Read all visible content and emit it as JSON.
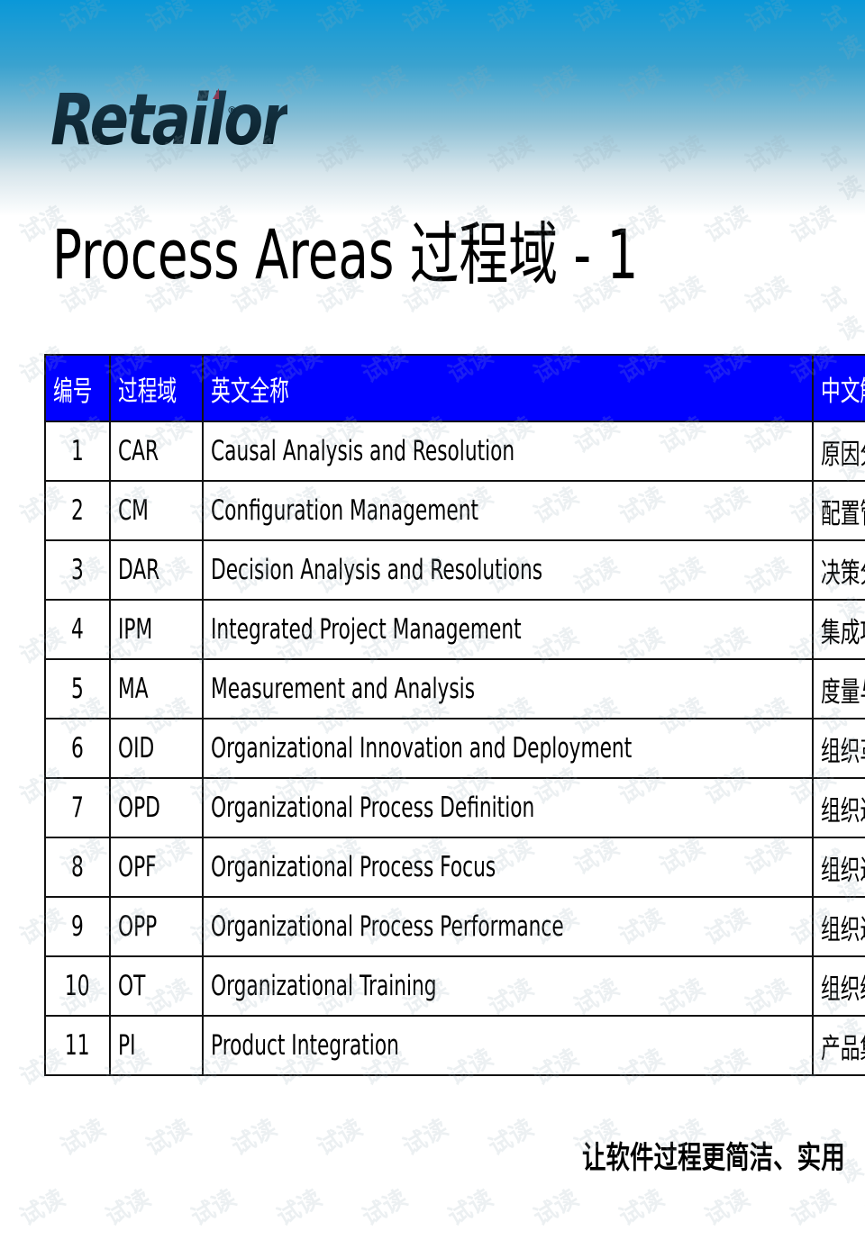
{
  "brand": {
    "logo_text": "Retailor",
    "registered_mark": "®"
  },
  "slide": {
    "title": "Process Areas 过程域 - 1"
  },
  "table": {
    "headers": [
      "编号",
      "过程域",
      "英文全称",
      "中文解释"
    ],
    "rows": [
      {
        "no": "1",
        "abbr": "CAR",
        "english": "Causal Analysis and Resolution",
        "chinese": "原因分析与解决方案"
      },
      {
        "no": "2",
        "abbr": "CM",
        "english": "Configuration Management",
        "chinese": "配置管理"
      },
      {
        "no": "3",
        "abbr": "DAR",
        "english": "Decision Analysis and Resolutions",
        "chinese": "决策分析"
      },
      {
        "no": "4",
        "abbr": "IPM",
        "english": "Integrated Project Management",
        "chinese": "集成项目管理"
      },
      {
        "no": "5",
        "abbr": "MA",
        "english": "Measurement and Analysis",
        "chinese": "度量与分析"
      },
      {
        "no": "6",
        "abbr": "OID",
        "english": "Organizational Innovation and Deployment",
        "chinese": "组织革新与部署"
      },
      {
        "no": "7",
        "abbr": "OPD",
        "english": "Organizational Process Definition",
        "chinese": "组织过程定义"
      },
      {
        "no": "8",
        "abbr": "OPF",
        "english": "Organizational Process Focus",
        "chinese": "组织过程关注"
      },
      {
        "no": "9",
        "abbr": "OPP",
        "english": "Organizational Process Performance",
        "chinese": "组织过程性能"
      },
      {
        "no": "10",
        "abbr": "OT",
        "english": "Organizational Training",
        "chinese": "组织级培训"
      },
      {
        "no": "11",
        "abbr": "PI",
        "english": "Product Integration",
        "chinese": "产品集成"
      }
    ]
  },
  "footer": {
    "slogan": "让软件过程更简洁、实用"
  },
  "watermark": {
    "text": "试读"
  },
  "colors": {
    "header_fill": "#0000ff",
    "header_text": "#ffffff",
    "logo": "#0d2a3a",
    "band_top": "#0a98d8"
  }
}
